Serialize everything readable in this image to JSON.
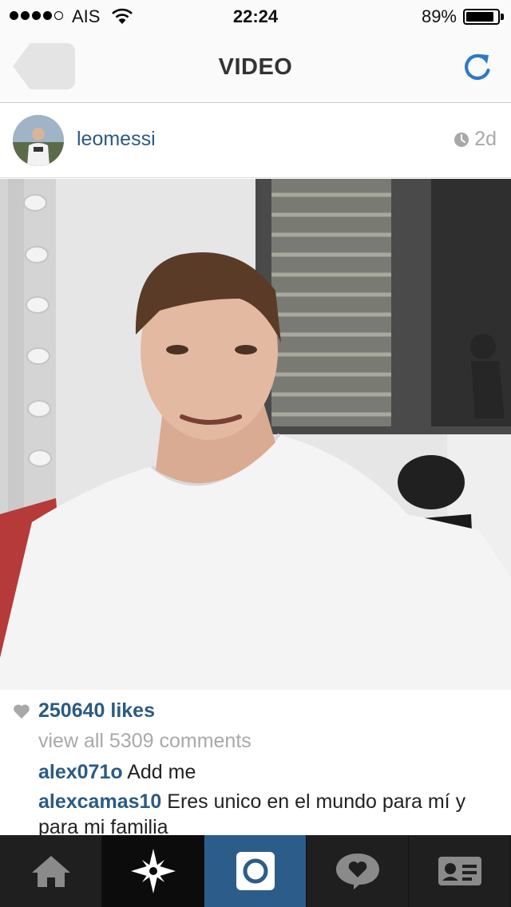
{
  "status_bar": {
    "carrier": "AIS",
    "time": "22:24",
    "battery_percent": "89%",
    "battery_level": 0.89,
    "signal_bars": 4
  },
  "nav": {
    "title": "VIDEO",
    "back_icon": "back-arrow-icon",
    "refresh_icon": "refresh-icon"
  },
  "post": {
    "username": "leomessi",
    "time_ago": "2d",
    "likes": "250640 likes",
    "view_comments": "view all 5309 comments",
    "comments": [
      {
        "user": "alex071o",
        "text": "Add me"
      },
      {
        "user": "alexcamas10",
        "text": "Eres unico en el mundo para mí y para mi familia"
      }
    ]
  },
  "tab_bar": {
    "tabs": [
      "home-icon",
      "explore-icon",
      "camera-icon",
      "activity-icon",
      "profile-icon"
    ],
    "active": "camera-icon"
  },
  "colors": {
    "link_blue": "#2b5a84",
    "tab_bar": "#1f1f1f",
    "tab_active": "#2c5d8a",
    "refresh_blue": "#2d7ac5"
  }
}
